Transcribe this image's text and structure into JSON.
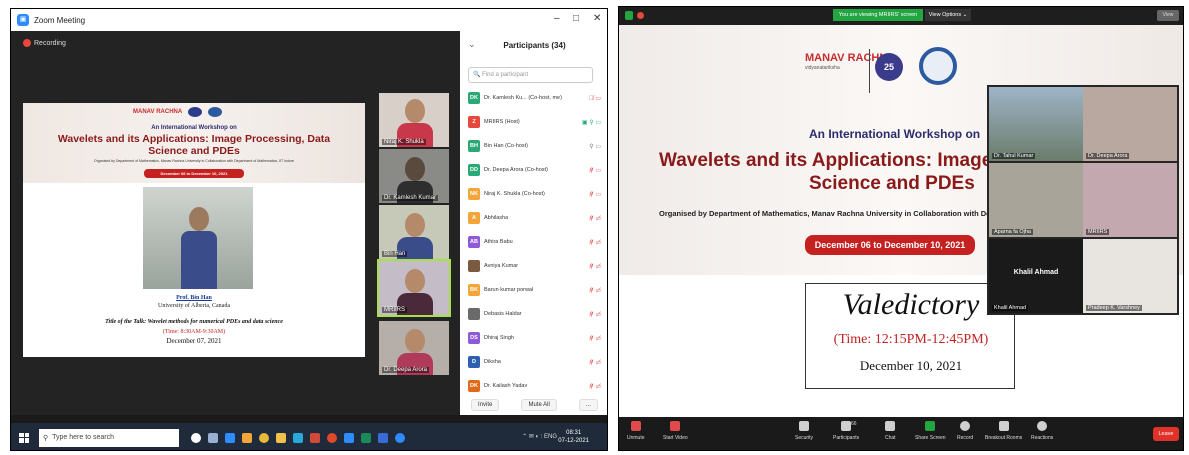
{
  "left": {
    "window_title": "Zoom Meeting",
    "recording": "Recording",
    "slide": {
      "banner_sub": "An International Workshop on",
      "banner_title": "Wavelets and its Applications: Image Processing, Data Science and PDEs",
      "org": "Organised by Department of Mathematics, Manav Rachna University in Collaboration with Department of Mathematics, IIT Indore",
      "date": "December 06 to December 10, 2021",
      "speaker": "Prof. Bin Han",
      "university": "University of Alberta, Canada",
      "talk": "Title of the Talk: Wavelet methods for numerical PDEs and data science",
      "time": "(Time: 8:30AM-9:30AM)",
      "day": "December 07, 2021"
    },
    "videos": [
      "Niraj K. Shukla",
      "Dr. Kamlesh Kumar",
      "Bin Han",
      "MRIIRS",
      "Dr. Deepa Arora"
    ],
    "participants": {
      "header": "Participants (34)",
      "search_placeholder": "Find a participant",
      "rows": [
        {
          "initials": "DK",
          "name": "Dr. Kamlesh Ku...  (Co-host, me)",
          "color": "#2aa876"
        },
        {
          "initials": "Z",
          "name": "MRIIRS (Host)",
          "color": "#e8473c"
        },
        {
          "initials": "BH",
          "name": "Bin Han (Co-host)",
          "color": "#2aa876"
        },
        {
          "initials": "DD",
          "name": "Dr. Deepa Arora (Co-host)",
          "color": "#2aa876"
        },
        {
          "initials": "NK",
          "name": "Niraj K. Shukla (Co-host)",
          "color": "#f4a53a"
        },
        {
          "initials": "A",
          "name": "Abhilasha",
          "color": "#f4a53a"
        },
        {
          "initials": "AB",
          "name": "Athira Babu",
          "color": "#8e5ad8"
        },
        {
          "initials": "",
          "name": "Avniya Kumar",
          "color": "#7a5a40"
        },
        {
          "initials": "BK",
          "name": "Barun kumar porwal",
          "color": "#f4a53a"
        },
        {
          "initials": "",
          "name": "Debasis Haldar",
          "color": "#6a6a6a"
        },
        {
          "initials": "DS",
          "name": "Dhiraj Singh",
          "color": "#8e5ad8"
        },
        {
          "initials": "D",
          "name": "Diksha",
          "color": "#2d5fb0"
        },
        {
          "initials": "DK",
          "name": "Dr. Kailash Yadav",
          "color": "#e06a1a"
        }
      ],
      "invite": "Invite",
      "mute_all": "Mute All",
      "more": "..."
    },
    "taskbar": {
      "search": "Type here to search",
      "tray": "ENG",
      "time": "08:31",
      "date": "07-12-2021"
    }
  },
  "right": {
    "viewing_banner": "You are viewing MRIIRS' screen",
    "view_options": "View Options",
    "view_btn": "View",
    "slide": {
      "brand": "MANAV RACHNA",
      "brand_tag": "vidyanatariksha",
      "badge": "25",
      "sub": "An International Workshop on",
      "title_line1": "Wavelets and its Applications: Image P",
      "title_line2": "Science and PDEs",
      "org": "Organised by Department of Mathematics, Manav Rachna University in Collaboration with De",
      "date": "December 06 to December 10, 2021",
      "valedictory": "Valedictory",
      "time": "(Time: 12:15PM-12:45PM)",
      "day": "December 10, 2021"
    },
    "gallery": [
      {
        "label": "Dr. Tahul Kumar"
      },
      {
        "label": "Dr. Deepa Arora"
      },
      {
        "label": "Aparna fa Ojha"
      },
      {
        "label": "MRIIRS"
      },
      {
        "label": "Khalil Ahmad",
        "center": "Khalil Ahmad"
      },
      {
        "label": "Pradeep K. Varshney"
      }
    ],
    "toolbar": {
      "unmute": "Unmute",
      "start_video": "Start Video",
      "security": "Security",
      "participants": "Participants",
      "participants_count": "66",
      "chat": "Chat",
      "share": "Share Screen",
      "record": "Record",
      "breakout": "Breakout Rooms",
      "reactions": "Reactions",
      "leave": "Leave"
    }
  }
}
